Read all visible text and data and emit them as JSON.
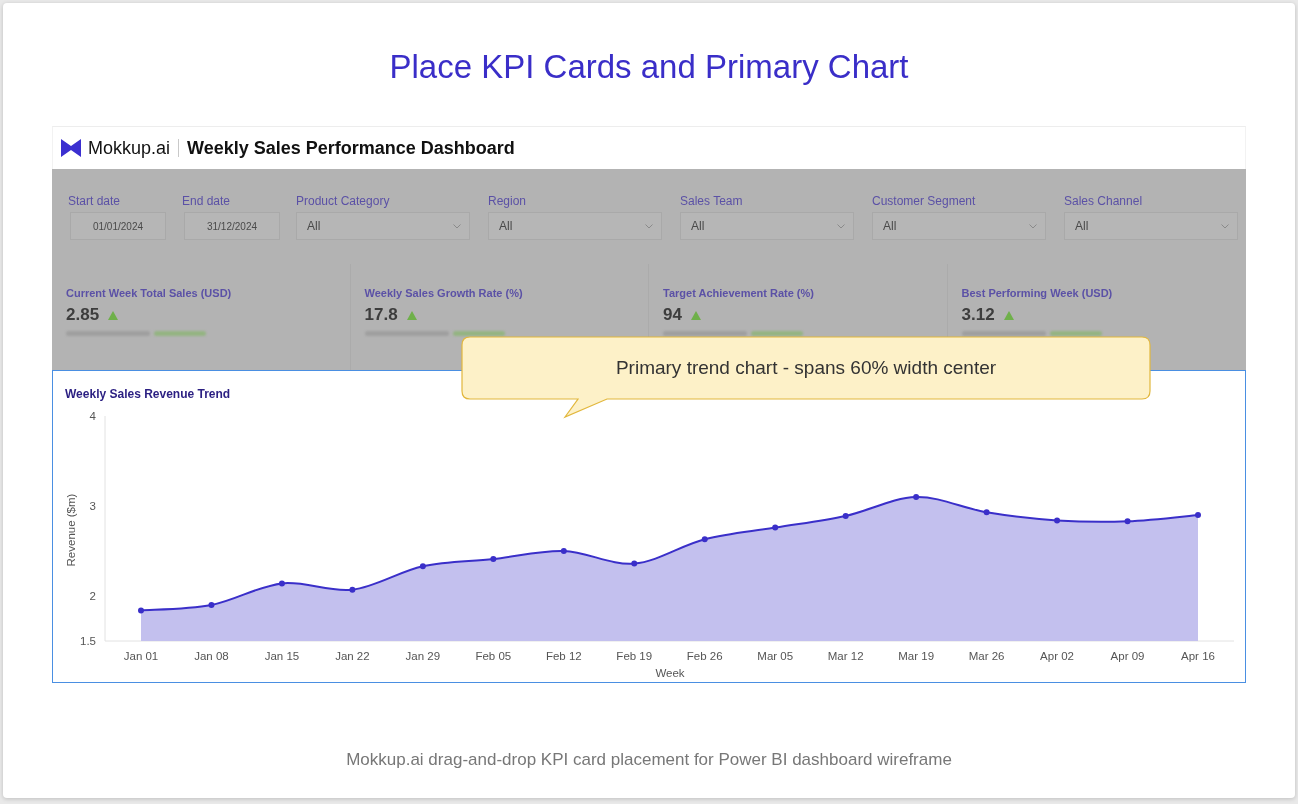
{
  "title": "Place KPI Cards and Primary Chart",
  "dashboard": {
    "brand": "Mokkup.ai",
    "title": "Weekly Sales Performance Dashboard",
    "dimmed": true,
    "filters": [
      {
        "label": "Start date",
        "kind": "date",
        "value": "01/01/2024"
      },
      {
        "label": "End date",
        "kind": "date",
        "value": "31/12/2024"
      },
      {
        "label": "Product Category",
        "kind": "dropdown",
        "value": "All"
      },
      {
        "label": "Region",
        "kind": "dropdown",
        "value": "All"
      },
      {
        "label": "Sales Team",
        "kind": "dropdown",
        "value": "All"
      },
      {
        "label": "Customer Segment",
        "kind": "dropdown",
        "value": "All"
      },
      {
        "label": "Sales Channel",
        "kind": "dropdown",
        "value": "All"
      }
    ],
    "kpi_cards": [
      {
        "label": "Current Week Total Sales (USD)",
        "value": "2.85",
        "rising": true
      },
      {
        "label": "Weekly Sales Growth Rate (%)",
        "value": "17.8",
        "rising": true
      },
      {
        "label": "Target Achievement Rate (%)",
        "value": "94",
        "rising": true
      },
      {
        "label": "Best Performing Week (USD)",
        "value": "3.12",
        "rising": true
      }
    ]
  },
  "chart": {
    "highlighted": true,
    "chart_data": {
      "type": "area",
      "title": "Weekly Sales Revenue Trend",
      "xlabel": "Week",
      "ylabel": "Revenue ($m)",
      "categories": [
        "Jan 01",
        "Jan 08",
        "Jan 15",
        "Jan 22",
        "Jan 29",
        "Feb 05",
        "Feb 12",
        "Feb 19",
        "Feb 26",
        "Mar 05",
        "Mar 12",
        "Mar 19",
        "Mar 26",
        "Apr 02",
        "Apr 09",
        "Apr 16"
      ],
      "values": [
        1.84,
        1.9,
        2.14,
        2.07,
        2.33,
        2.41,
        2.5,
        2.36,
        2.63,
        2.76,
        2.89,
        3.1,
        2.93,
        2.84,
        2.83,
        2.9
      ],
      "ylim": [
        1.5,
        4
      ],
      "yticks": [
        1.5,
        2,
        3,
        4
      ]
    }
  },
  "callout": {
    "text": "Primary trend chart - spans 60% width center"
  },
  "caption": "Mokkup.ai drag-and-drop KPI card placement for Power BI dashboard wireframe"
}
